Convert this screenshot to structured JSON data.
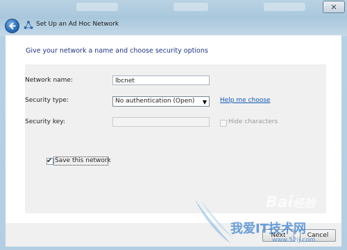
{
  "window": {
    "title": "Set Up an Ad Hoc Network",
    "close_glyph": "✕"
  },
  "content": {
    "heading": "Give your network a name and choose security options"
  },
  "form": {
    "network_name_label": "Network name:",
    "network_name_value": "lbcnet",
    "security_type_label": "Security type:",
    "security_type_value": "No authentication (Open)",
    "help_link": "Help me choose",
    "security_key_label": "Security key:",
    "security_key_value": "",
    "hide_characters_label": "Hide characters",
    "hide_characters_checked": false,
    "save_network_label": "Save this network",
    "save_network_checked": true
  },
  "footer": {
    "next_label": "Next",
    "cancel_label": "Cancel"
  },
  "watermark": {
    "brand": "Bai",
    "brand_cn": "经验",
    "site_cn": "我爱IT技术网",
    "url": "www.52ij.com"
  },
  "colors": {
    "heading": "#1e3287",
    "link": "#0f56b8",
    "panel": "#f0f0f0",
    "frame": "#b7d0e4"
  }
}
